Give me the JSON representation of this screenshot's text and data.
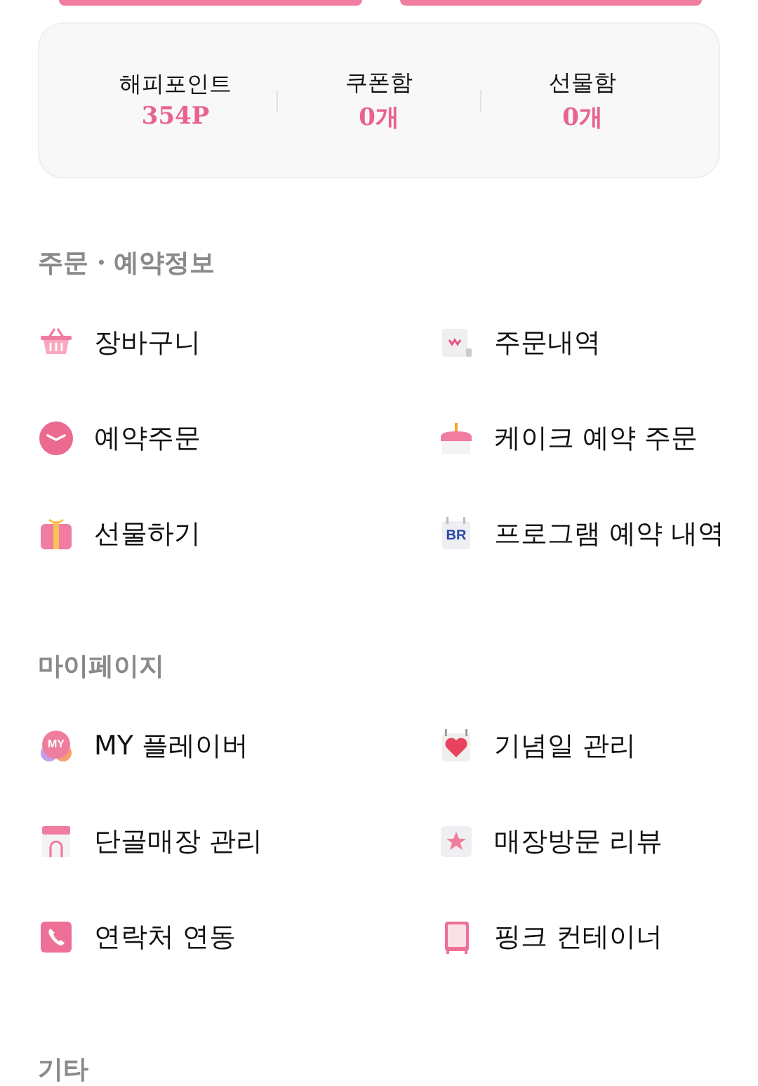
{
  "stats": [
    {
      "label": "해피포인트",
      "value": "354P"
    },
    {
      "label": "쿠폰함",
      "value": "0개"
    },
    {
      "label": "선물함",
      "value": "0개"
    }
  ],
  "sections": [
    {
      "title": "주문・예약정보",
      "items": [
        {
          "label": "장바구니"
        },
        {
          "label": "주문내역"
        },
        {
          "label": "예약주문"
        },
        {
          "label": "케이크 예약 주문"
        },
        {
          "label": "선물하기"
        },
        {
          "label": "프로그램 예약 내역",
          "icon_text": "BR"
        }
      ]
    },
    {
      "title": "마이페이지",
      "items": [
        {
          "label": "MY 플레이버",
          "icon_text": "MY"
        },
        {
          "label": "기념일 관리"
        },
        {
          "label": "단골매장 관리"
        },
        {
          "label": "매장방문 리뷰"
        },
        {
          "label": "연락처 연동"
        },
        {
          "label": "핑크 컨테이너"
        }
      ]
    },
    {
      "title": "기타"
    }
  ]
}
